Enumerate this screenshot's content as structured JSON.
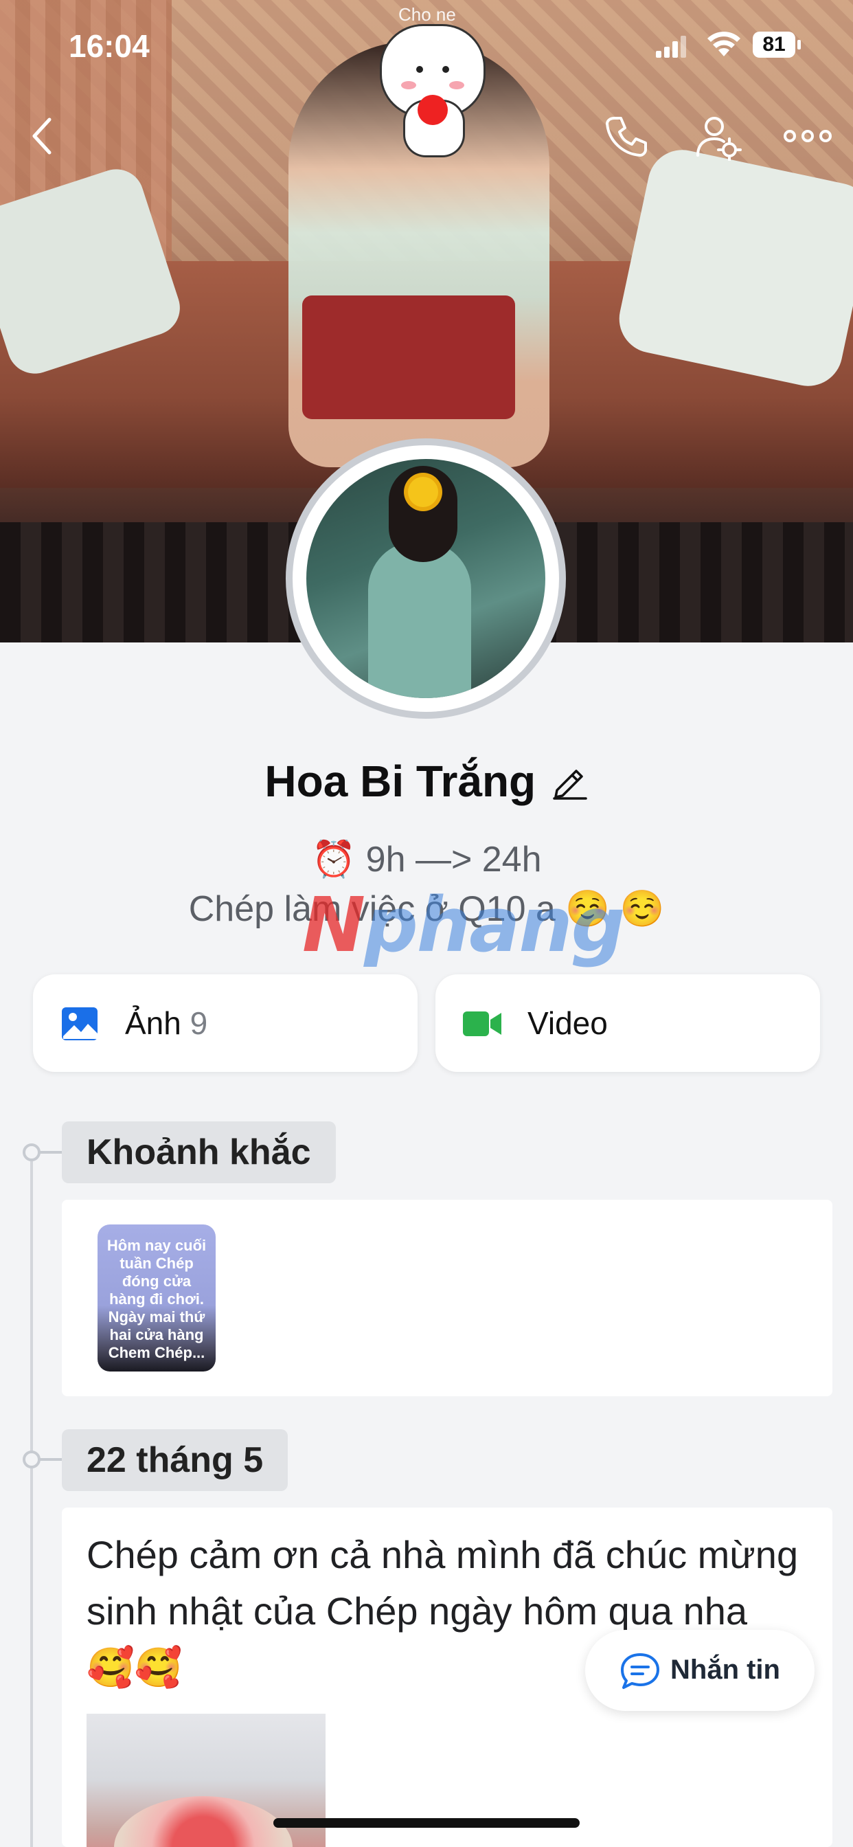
{
  "status_bar": {
    "time": "16:04",
    "battery": "81"
  },
  "cover": {
    "top_text": "Cho ne"
  },
  "nav": {
    "back_icon": "chevron-left-icon",
    "call_icon": "phone-icon",
    "settings_icon": "user-settings-icon",
    "more_icon": "more-icon"
  },
  "profile": {
    "name": "Hoa Bi Trắng",
    "bio_line1": "⏰ 9h —> 24h",
    "bio_line2": "Chép làm việc ở Q10 a ☺️ ☺️",
    "watermark": {
      "part1": "N",
      "part2": "phang"
    }
  },
  "media_buttons": {
    "photo": {
      "label": "Ảnh",
      "count": "9"
    },
    "video": {
      "label": "Video"
    }
  },
  "timeline": {
    "moments": {
      "tag": "Khoảnh khắc",
      "thumb_text": "Hôm nay cuối tuần Chép đóng cửa hàng đi chơi. Ngày mai thứ hai cửa hàng Chem Chép..."
    },
    "post": {
      "date": "22 tháng 5",
      "text": "Chép cảm ơn cả nhà mình đã chúc mừng sinh nhật của Chép ngày hôm qua nha 🥰🥰"
    }
  },
  "message_button": {
    "label": "Nhắn tin"
  },
  "colors": {
    "accent_blue": "#1a73e8",
    "photo_icon": "#1a6fe8",
    "video_icon": "#2bb24c",
    "background": "#f3f4f6"
  }
}
